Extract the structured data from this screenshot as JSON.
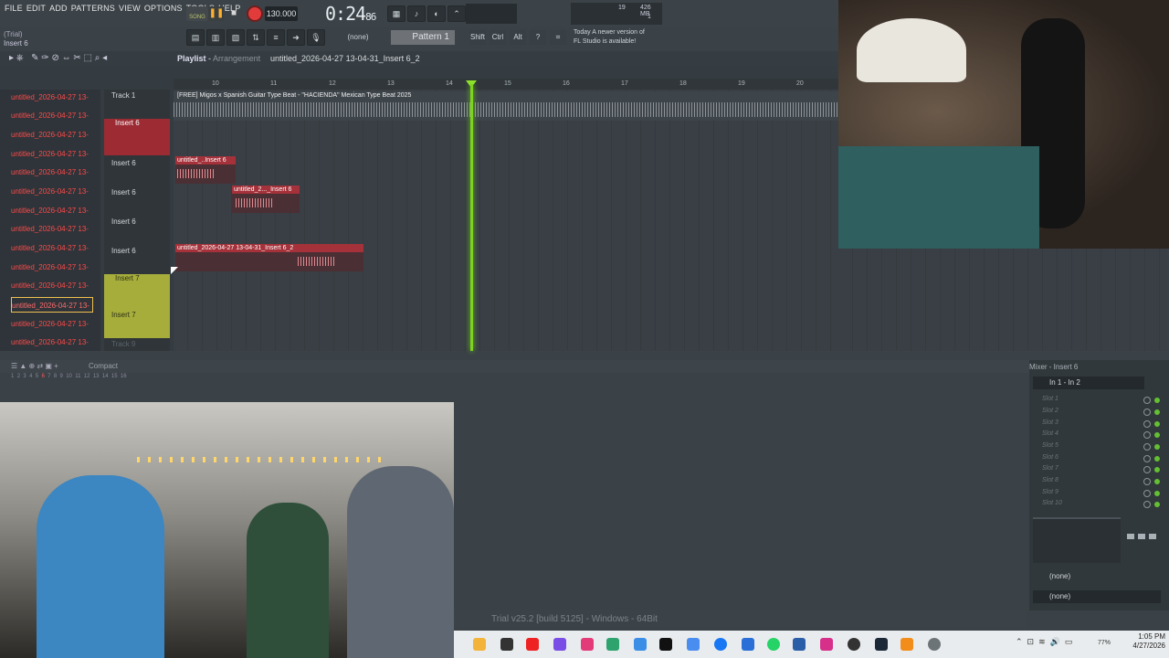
{
  "menu": [
    "FILE",
    "EDIT",
    "ADD",
    "PATTERNS",
    "VIEW",
    "OPTIONS",
    "TOOLS",
    "HELP"
  ],
  "trial_label": "(Trial)",
  "hint_text": "Insert 6",
  "transport": {
    "song": "SONG",
    "tempo": "130.000",
    "time": "0:24",
    "time_small": "86"
  },
  "cpu": {
    "voices": "19",
    "memory": "426 MB",
    "one": "1"
  },
  "toolbar2": {
    "none_label": "(none)",
    "pattern": "Pattern 1",
    "shift": "Shift",
    "ctrl": "Ctrl",
    "alt": "Alt"
  },
  "news": {
    "line1": "Today  A newer version of",
    "line2": "FL Studio is available!"
  },
  "playlist": {
    "title": "Playlist",
    "sub": "Arrangement",
    "file": "untitled_2026-04-27 13-04-31_Insert 6_2"
  },
  "ruler": [
    "10",
    "11",
    "12",
    "13",
    "14",
    "15",
    "16",
    "17",
    "18",
    "19",
    "20"
  ],
  "picker": [
    "untitled_2026-04-27 13-",
    "untitled_2026-04-27 13-",
    "untitled_2026-04-27 13-",
    "untitled_2026-04-27 13-",
    "untitled_2026-04-27 13-",
    "untitled_2026-04-27 13-",
    "untitled_2026-04-27 13-",
    "untitled_2026-04-27 13-",
    "untitled_2026-04-27 13-",
    "untitled_2026-04-27 13-",
    "untitled_2026-04-27 13-",
    "untitled_2026-04-27 13-",
    "untitled_2026-04-27 13-",
    "untitled_2026-04-27 13-"
  ],
  "tracks": [
    "Track 1",
    "Insert 6",
    "Insert 6",
    "Insert 6",
    "Insert 6",
    "Insert 6",
    "Insert 7",
    "Insert 7",
    "Track 9"
  ],
  "clips": {
    "beat": "[FREE] Migos x Spanish Guitar Type Beat - \"HACIENDA\" Mexican Type Beat 2025",
    "c1": "untitled_..Insert 6",
    "c2": "untitled_2..._Insert 6",
    "c3": "untitled_2026-04-27 13-04-31_Insert 6_2"
  },
  "bottom": {
    "compact": "Compact",
    "steps": [
      "1",
      "2",
      "3",
      "4",
      "5",
      "6",
      "7",
      "8",
      "9",
      "10",
      "11",
      "12",
      "13",
      "14",
      "15",
      "16"
    ]
  },
  "status": "Trial v25.2 [build 5125] - Windows - 64Bit",
  "mixer": {
    "title": "Mixer - Insert 6",
    "input": "In 1 - In 2",
    "slots": [
      "Slot 1",
      "Slot 2",
      "Slot 3",
      "Slot 4",
      "Slot 5",
      "Slot 6",
      "Slot 7",
      "Slot 8",
      "Slot 9",
      "Slot 10"
    ],
    "none1": "(none)",
    "none2": "(none)"
  },
  "clock": {
    "time": "1:05 PM",
    "date": "4/27/2026",
    "battery": "77%"
  },
  "colors": {
    "accent": "#ff9a00",
    "playhead": "#7bd41d",
    "record": "#e13b3b",
    "insert6": "#9c2b33",
    "insert7": "#a7ad3b"
  }
}
